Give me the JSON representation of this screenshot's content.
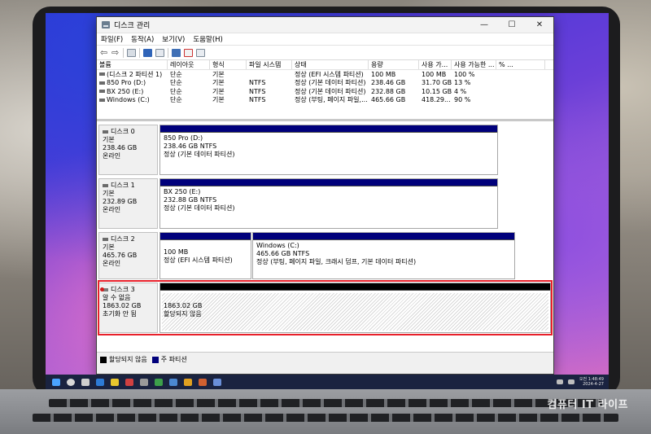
{
  "window": {
    "title": "디스크 관리",
    "controls": {
      "minimize": "—",
      "maximize": "☐",
      "close": "✕"
    }
  },
  "menu": [
    "파일(F)",
    "동작(A)",
    "보기(V)",
    "도움말(H)"
  ],
  "columns": [
    "볼륨",
    "레이아웃",
    "형식",
    "파일 시스템",
    "상태",
    "용량",
    "사용 가...",
    "사용 가능한 ...",
    "% ..."
  ],
  "volumes": [
    {
      "name": "(디스크 2 파티션 1)",
      "layout": "단순",
      "type": "기본",
      "fs": "",
      "status": "정상 (EFI 시스템 파티션)",
      "capacity": "100 MB",
      "free": "100 MB",
      "pct": "100 %"
    },
    {
      "name": "850 Pro (D:)",
      "layout": "단순",
      "type": "기본",
      "fs": "NTFS",
      "status": "정상 (기본 데이터 파티션)",
      "capacity": "238.46 GB",
      "free": "31.70 GB",
      "pct": "13 %"
    },
    {
      "name": "BX 250 (E:)",
      "layout": "단순",
      "type": "기본",
      "fs": "NTFS",
      "status": "정상 (기본 데이터 파티션)",
      "capacity": "232.88 GB",
      "free": "10.15 GB",
      "pct": "4 %"
    },
    {
      "name": "Windows (C:)",
      "layout": "단순",
      "type": "기본",
      "fs": "NTFS",
      "status": "정상 (부팅, 페이지 파일,...",
      "capacity": "465.66 GB",
      "free": "418.29...",
      "pct": "90 %"
    }
  ],
  "disks": [
    {
      "name": "디스크 0",
      "kind": "기본",
      "size": "238.46 GB",
      "state": "온라인",
      "partitions": [
        {
          "title": "850 Pro  (D:)",
          "size": "238.46 GB NTFS",
          "status": "정상 (기본 데이터 파티션)"
        }
      ]
    },
    {
      "name": "디스크 1",
      "kind": "기본",
      "size": "232.89 GB",
      "state": "온라인",
      "partitions": [
        {
          "title": "BX 250  (E:)",
          "size": "232.88 GB NTFS",
          "status": "정상 (기본 데이터 파티션)"
        }
      ]
    },
    {
      "name": "디스크 2",
      "kind": "기본",
      "size": "465.76 GB",
      "state": "온라인",
      "partitions": [
        {
          "title": "",
          "size": "100 MB",
          "status": "정상 (EFI 시스템 파티션)"
        },
        {
          "title": "Windows  (C:)",
          "size": "465.66 GB NTFS",
          "status": "정상 (부팅, 페이지 파일, 크래시 덤프, 기본 데이터 파티션)"
        }
      ]
    },
    {
      "name": "디스크 3",
      "kind": "알 수 없음",
      "size": "1863.02 GB",
      "state": "초기화 안 됨",
      "partitions": [
        {
          "title": "",
          "size": "1863.02 GB",
          "status": "할당되지 않음"
        }
      ]
    }
  ],
  "legend": {
    "unallocated": "할당되지 않음",
    "primary": "주 파티션"
  },
  "colors": {
    "primary_bar": "#00007b",
    "unallocated_bar": "#000000",
    "highlight": "#e8202a"
  },
  "taskbar": {
    "clock_time": "오전 1:48:49",
    "clock_date": "2024-4-27"
  },
  "watermark": "컴퓨터 IT 라이프"
}
